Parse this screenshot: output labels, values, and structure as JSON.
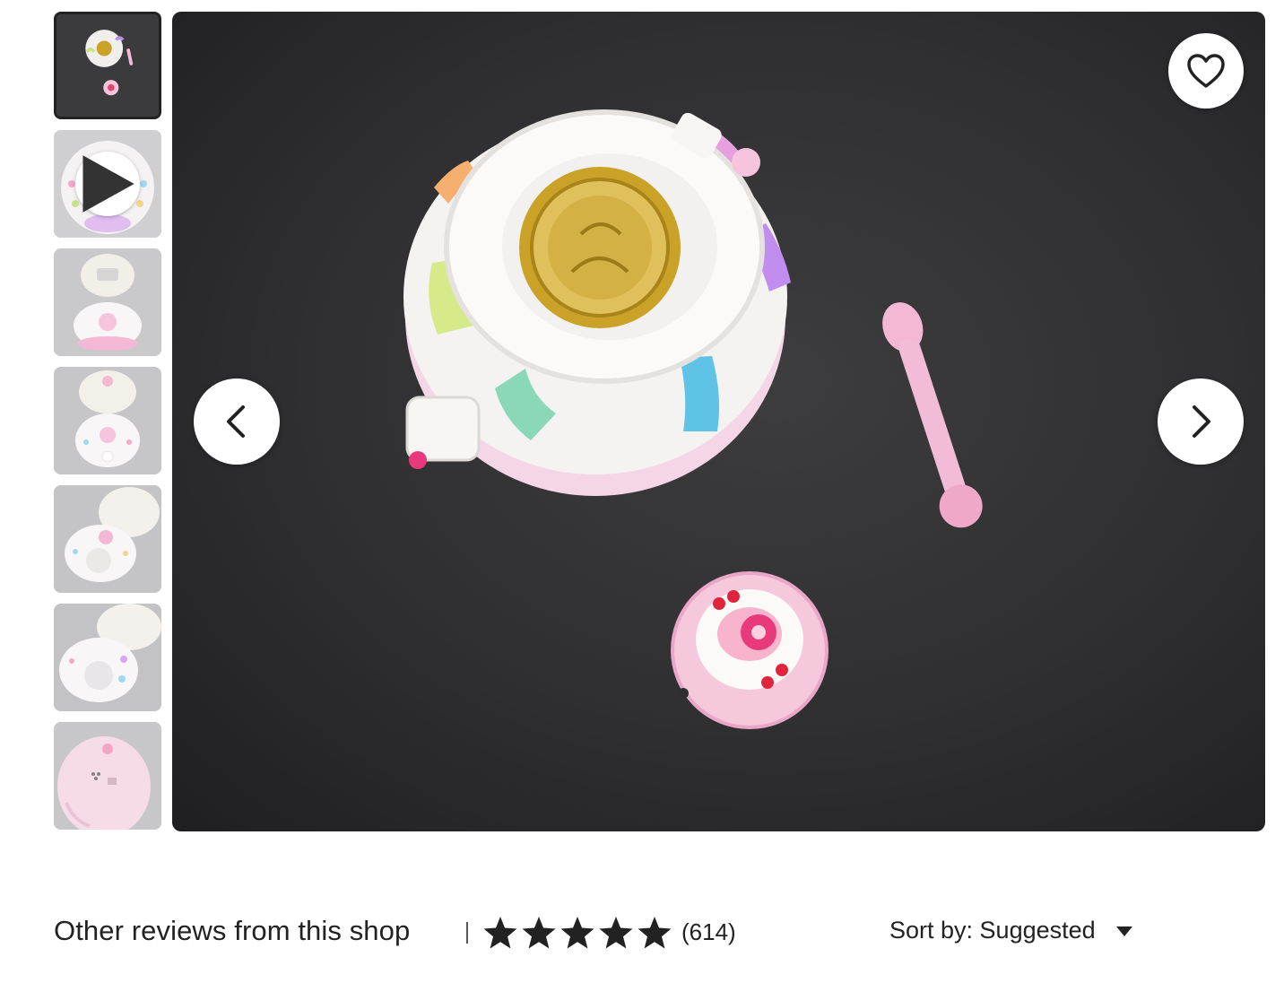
{
  "gallery": {
    "thumbnails": [
      {
        "kind": "photo",
        "selected": true
      },
      {
        "kind": "video",
        "selected": false
      },
      {
        "kind": "photo",
        "selected": false
      },
      {
        "kind": "photo",
        "selected": false
      },
      {
        "kind": "photo",
        "selected": false
      },
      {
        "kind": "photo",
        "selected": false
      },
      {
        "kind": "photo",
        "selected": false
      }
    ],
    "favorite_icon": "heart-outline-icon",
    "prev_icon": "chevron-left-icon",
    "next_icon": "chevron-right-icon",
    "play_icon": "play-icon"
  },
  "reviews": {
    "title": "Other reviews from this shop",
    "separator": "|",
    "rating_stars": 5,
    "count": "(614)",
    "sort_label": "Sort by: Suggested",
    "sort_icon": "caret-down-icon"
  },
  "colors": {
    "text": "#222222",
    "photo_background": "#2f2f31",
    "toy_pink": "#f2b8d4",
    "toy_white": "#f4f2f2",
    "medallion_gold": "#c9a227"
  }
}
